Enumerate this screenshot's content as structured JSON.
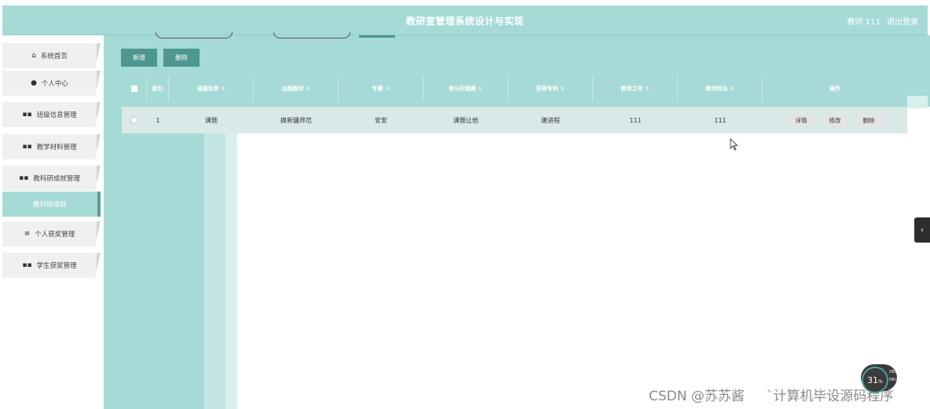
{
  "header": {
    "title": "教研室管理系统设计与实现",
    "user_label": "教师 111",
    "logout_label": "退出登录"
  },
  "sidebar": {
    "items": [
      {
        "label": "系统首页",
        "icon": "home-icon",
        "glyph": "⌂"
      },
      {
        "label": "个人中心",
        "icon": "user-icon",
        "glyph": "●"
      },
      {
        "label": "班级信息管理",
        "icon": "grid-icon",
        "glyph": "▪▪"
      },
      {
        "label": "教学材料管理",
        "icon": "grid-icon",
        "glyph": "▪▪"
      },
      {
        "label": "教科研成就管理",
        "icon": "grid-icon",
        "glyph": "▪▪"
      },
      {
        "label": "教科研成就",
        "icon": "",
        "glyph": ""
      },
      {
        "label": "个人获奖管理",
        "icon": "list-icon",
        "glyph": "≡"
      },
      {
        "label": "学生获奖管理",
        "icon": "grid-icon",
        "glyph": "▪▪"
      }
    ],
    "active_index": 5
  },
  "toolbar": {
    "add_label": "新增",
    "delete_label": "删除"
  },
  "table": {
    "columns": [
      "",
      "索引",
      "课题名称",
      "出版教材",
      "专著",
      "参与的课题",
      "获得专利",
      "教师工号",
      "教师姓名",
      "操作"
    ],
    "rows": [
      {
        "index": "1",
        "topic": "课题",
        "textbook": "换新疆师范",
        "monograph": "安安",
        "participation": "课题让他",
        "patent": "建进程",
        "teacher_no": "111",
        "teacher_name": "111"
      }
    ],
    "row_actions": [
      "详情",
      "修改",
      "删除"
    ]
  },
  "side_toggle_glyph": "‹",
  "watermark": {
    "left": "CSDN @苏苏酱",
    "right": "`计算机毕设源码程序"
  },
  "speed_widget": {
    "percent": "31",
    "percent_unit": "%",
    "up": "0",
    "down": "0",
    "rate_unit": "K/s"
  },
  "colors": {
    "accent": "#a6dad7",
    "button": "#4e9690",
    "row_bg": "#dae8e7"
  }
}
